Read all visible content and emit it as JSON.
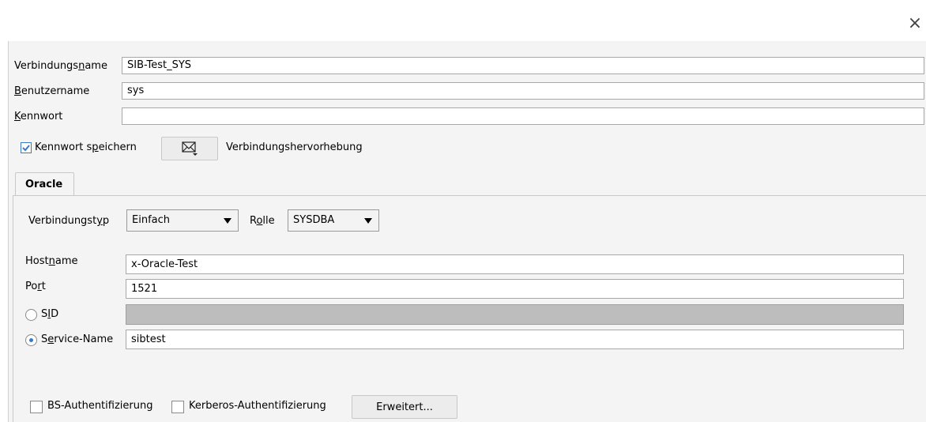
{
  "dialog": {
    "close_glyph": "×"
  },
  "connection": {
    "name_label_pre": "Verbindungs",
    "name_label_u": "n",
    "name_label_post": "ame",
    "name_value": "SIB-Test_SYS",
    "user_label_u": "B",
    "user_label_post": "enutzername",
    "user_value": "sys",
    "password_label_u": "K",
    "password_label_post": "ennwort",
    "password_value": ""
  },
  "save_password": {
    "label_pre": "Kennwort s",
    "label_u": "p",
    "label_post": "eichern",
    "checked": true
  },
  "highlight": {
    "label": "Verbindungshervorhebung",
    "icon": "envelope-icon"
  },
  "tabs": [
    {
      "label": "Oracle",
      "active": true
    }
  ],
  "oracle": {
    "conn_type_label_pre": "Verbindungst",
    "conn_type_label_u": "y",
    "conn_type_label_post": "p",
    "conn_type_value": "Einfach",
    "role_label_pre": "R",
    "role_label_u": "o",
    "role_label_post": "lle",
    "role_value": "SYSDBA",
    "host_label_pre": "Host",
    "host_label_u": "n",
    "host_label_post": "ame",
    "host_value": "x-Oracle-Test",
    "port_label_pre": "Po",
    "port_label_u": "r",
    "port_label_post": "t",
    "port_value": "1521",
    "sid_label_pre": "S",
    "sid_label_u": "I",
    "sid_label_post": "D",
    "sid_value": "",
    "service_label_pre": "S",
    "service_label_u": "e",
    "service_label_post": "rvice-Name",
    "service_value": "sibtest",
    "os_auth_label": "BS-Authentifizierung",
    "kerberos_label": "Kerberos-Authentifizierung",
    "advanced_label": "Erweitert..."
  },
  "colors": {
    "accent": "#3a79c6",
    "panel": "#f4f4f4",
    "disabled_field": "#bdbdbd"
  }
}
